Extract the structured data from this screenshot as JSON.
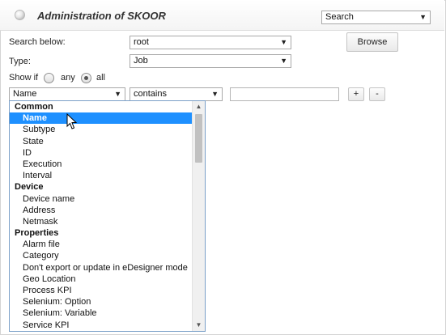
{
  "header": {
    "title": "Administration of SKOOR",
    "mode_select": "Search"
  },
  "form": {
    "search_below_label": "Search below:",
    "search_below_value": "root",
    "browse_label": "Browse",
    "type_label": "Type:",
    "type_value": "Job",
    "show_if_label": "Show if",
    "radio_any": "any",
    "radio_all": "all",
    "radio_selected": "all"
  },
  "filter": {
    "field_value": "Name",
    "operator_value": "contains",
    "filter_text": "",
    "add_label": "+",
    "remove_label": "-"
  },
  "dropdown": {
    "selected": "Name",
    "items": [
      {
        "kind": "group",
        "label": "Common"
      },
      {
        "kind": "option",
        "label": "Name",
        "selected": true
      },
      {
        "kind": "option",
        "label": "Subtype"
      },
      {
        "kind": "option",
        "label": "State"
      },
      {
        "kind": "option",
        "label": "ID"
      },
      {
        "kind": "option",
        "label": "Execution"
      },
      {
        "kind": "option",
        "label": "Interval"
      },
      {
        "kind": "group",
        "label": "Device"
      },
      {
        "kind": "option",
        "label": "Device name"
      },
      {
        "kind": "option",
        "label": "Address"
      },
      {
        "kind": "option",
        "label": "Netmask"
      },
      {
        "kind": "group",
        "label": "Properties"
      },
      {
        "kind": "option",
        "label": "Alarm file"
      },
      {
        "kind": "option",
        "label": "Category"
      },
      {
        "kind": "option",
        "label": "Don't export or update in eDesigner mode"
      },
      {
        "kind": "option",
        "label": "Geo Location"
      },
      {
        "kind": "option",
        "label": "Process KPI"
      },
      {
        "kind": "option",
        "label": "Selenium: Option"
      },
      {
        "kind": "option",
        "label": "Selenium: Variable"
      },
      {
        "kind": "option",
        "label": "Service KPI"
      }
    ]
  },
  "colors": {
    "selection": "#1e90ff",
    "list_border": "#7ba0c8"
  }
}
